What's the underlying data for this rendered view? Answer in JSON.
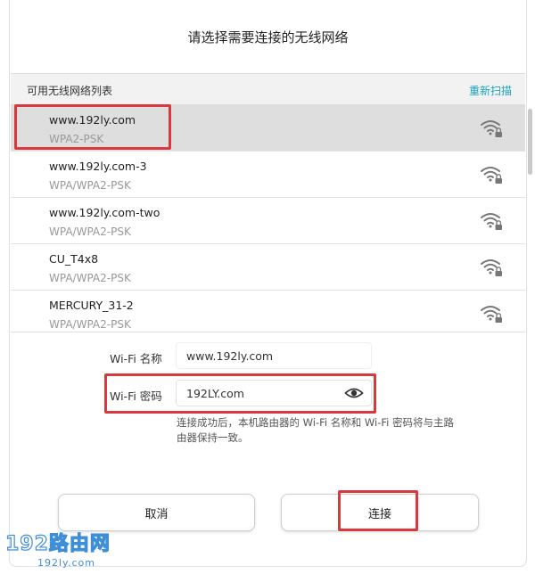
{
  "dialog": {
    "title": "请选择需要连接的无线网络"
  },
  "list_header": {
    "label": "可用无线网络列表",
    "rescan": "重新扫描"
  },
  "networks": [
    {
      "name": "www.192ly.com",
      "security": "WPA2-PSK",
      "selected": true
    },
    {
      "name": "www.192ly.com-3",
      "security": "WPA/WPA2-PSK"
    },
    {
      "name": "www.192ly.com-two",
      "security": "WPA/WPA2-PSK"
    },
    {
      "name": "CU_T4x8",
      "security": "WPA/WPA2-PSK"
    },
    {
      "name": "MERCURY_31-2",
      "security": "WPA/WPA2-PSK"
    }
  ],
  "form": {
    "wifi_name_label": "Wi-Fi 名称",
    "wifi_name_value": "www.192ly.com",
    "wifi_password_label": "Wi-Fi 密码",
    "wifi_password_value": "192LY.com",
    "hint": "连接成功后，本机路由器的 Wi-Fi 名称和 Wi-Fi 密码将与主路由器保持一致。"
  },
  "buttons": {
    "cancel": "取消",
    "connect": "连接"
  },
  "watermark": {
    "text_main": "192路由网",
    "text_sub": "192ly.com"
  },
  "colors": {
    "accent": "#1aa3b8",
    "highlight": "#d9383e",
    "watermark": "#3f8fd8"
  }
}
